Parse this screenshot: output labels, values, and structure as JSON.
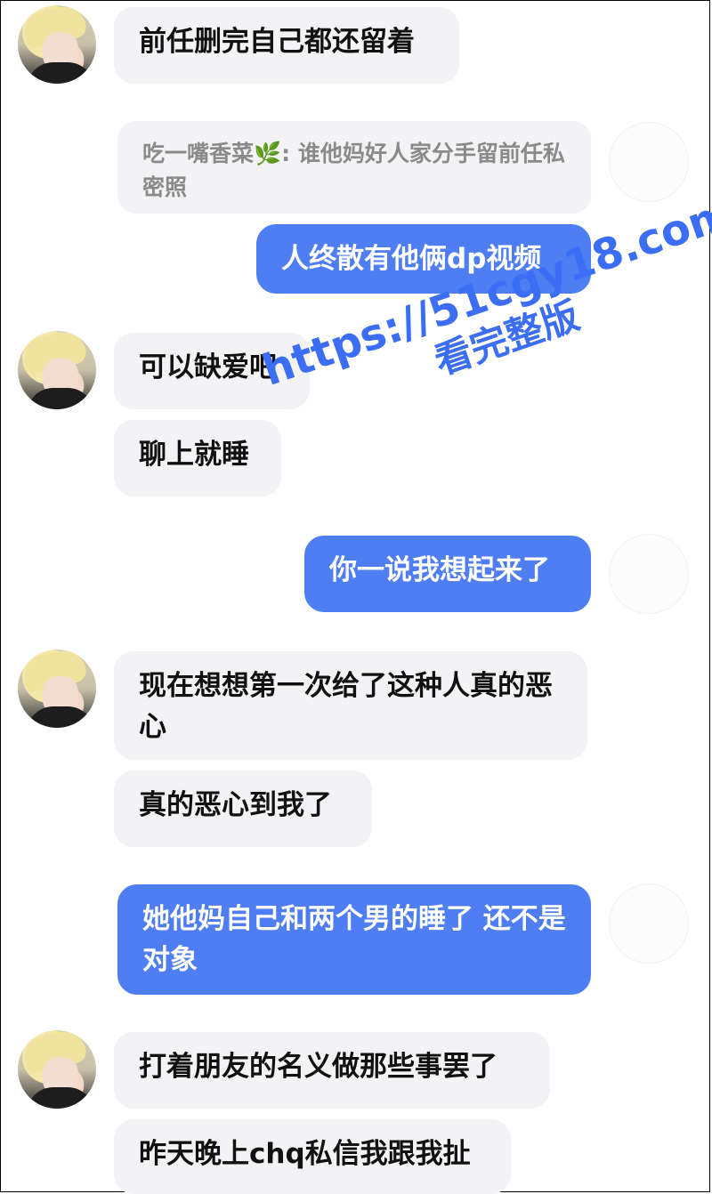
{
  "messages": [
    {
      "side": "in",
      "text": "前任删完自己都还留着"
    },
    {
      "side": "quote",
      "author": "吃一嘴香菜",
      "leaf": "🌿",
      "sep": ":",
      "text": "谁他妈好人家分手留前任私密照"
    },
    {
      "side": "out",
      "text": "人终散有他俩dp视频"
    },
    {
      "side": "in",
      "text": "可以缺爱吧"
    },
    {
      "side": "in",
      "text": "聊上就睡"
    },
    {
      "side": "out",
      "text": "你一说我想起来了"
    },
    {
      "side": "in",
      "text": "现在想想第一次给了这种人真的恶心"
    },
    {
      "side": "in",
      "text": "真的恶心到我了"
    },
    {
      "side": "out",
      "text": "她他妈自己和两个男的睡了 还不是对象"
    },
    {
      "side": "in",
      "text": "打着朋友的名义做那些事罢了"
    },
    {
      "side": "in",
      "text": "昨天晚上chq私信我跟我扯"
    }
  ],
  "watermark": {
    "url": "https://51cgy18.com",
    "caption": "看完整版"
  },
  "colors": {
    "outgoing": "#4f7ef2",
    "incoming": "#f3f3f5",
    "watermark": "#3b6ef5"
  }
}
